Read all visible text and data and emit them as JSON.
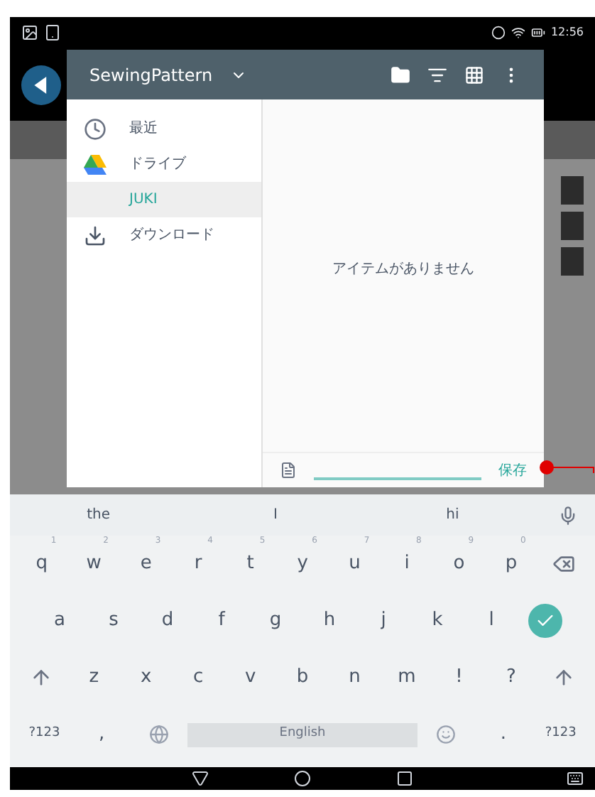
{
  "status_bar": {
    "time": "12:56"
  },
  "dialog": {
    "title": "SewingPattern",
    "sidebar": {
      "items": [
        {
          "kind": "recent",
          "label": "最近",
          "selected": false
        },
        {
          "kind": "drive",
          "label": "ドライブ",
          "selected": false
        },
        {
          "kind": "folder",
          "label": "JUKI",
          "selected": true
        },
        {
          "kind": "download",
          "label": "ダウンロード",
          "selected": false
        }
      ]
    },
    "empty_message": "アイテムがありません",
    "save_button": "保存"
  },
  "keyboard": {
    "suggestions": [
      "the",
      "I",
      "hi"
    ],
    "rows": [
      {
        "keys": [
          {
            "kind": "char",
            "label": "q",
            "hint": "1"
          },
          {
            "kind": "char",
            "label": "w",
            "hint": "2"
          },
          {
            "kind": "char",
            "label": "e",
            "hint": "3"
          },
          {
            "kind": "char",
            "label": "r",
            "hint": "4"
          },
          {
            "kind": "char",
            "label": "t",
            "hint": "5"
          },
          {
            "kind": "char",
            "label": "y",
            "hint": "6"
          },
          {
            "kind": "char",
            "label": "u",
            "hint": "7"
          },
          {
            "kind": "char",
            "label": "i",
            "hint": "8"
          },
          {
            "kind": "char",
            "label": "o",
            "hint": "9"
          },
          {
            "kind": "char",
            "label": "p",
            "hint": "0"
          },
          {
            "kind": "backspace"
          }
        ]
      },
      {
        "keys": [
          {
            "kind": "char",
            "label": "a"
          },
          {
            "kind": "char",
            "label": "s"
          },
          {
            "kind": "char",
            "label": "d"
          },
          {
            "kind": "char",
            "label": "f"
          },
          {
            "kind": "char",
            "label": "g"
          },
          {
            "kind": "char",
            "label": "h"
          },
          {
            "kind": "char",
            "label": "j"
          },
          {
            "kind": "char",
            "label": "k"
          },
          {
            "kind": "char",
            "label": "l"
          },
          {
            "kind": "enter"
          }
        ]
      },
      {
        "keys": [
          {
            "kind": "shift"
          },
          {
            "kind": "char",
            "label": "z"
          },
          {
            "kind": "char",
            "label": "x"
          },
          {
            "kind": "char",
            "label": "c"
          },
          {
            "kind": "char",
            "label": "v"
          },
          {
            "kind": "char",
            "label": "b"
          },
          {
            "kind": "char",
            "label": "n"
          },
          {
            "kind": "char",
            "label": "m"
          },
          {
            "kind": "char",
            "label": "!"
          },
          {
            "kind": "char",
            "label": "?"
          },
          {
            "kind": "shift"
          }
        ]
      },
      {
        "keys": [
          {
            "kind": "char",
            "label": "?123"
          },
          {
            "kind": "char",
            "label": ","
          },
          {
            "kind": "globe"
          },
          {
            "kind": "space",
            "label": "English"
          },
          {
            "kind": "emoji"
          },
          {
            "kind": "char",
            "label": "."
          },
          {
            "kind": "char",
            "label": "?123"
          }
        ]
      }
    ]
  }
}
